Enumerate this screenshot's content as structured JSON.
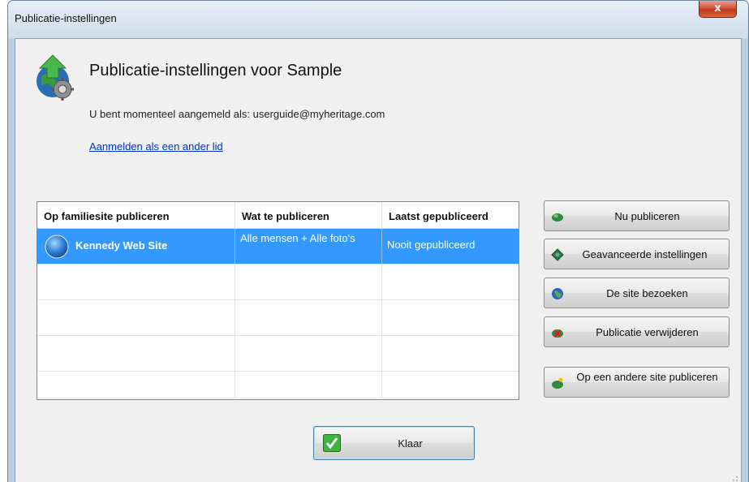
{
  "window": {
    "title": "Publicatie-instellingen",
    "close_glyph": "x"
  },
  "header": {
    "title": "Publicatie-instellingen voor Sample",
    "signed_in_text": "U bent momenteel aangemeld als: userguide@myheritage.com",
    "change_member_link": "Aanmelden als een ander lid",
    "icon": "publish-gear-globe-icon"
  },
  "table": {
    "columns": [
      "Op familiesite publiceren",
      "Wat te publiceren",
      "Laatst gepubliceerd"
    ],
    "rows": [
      {
        "site": "Kennedy Web Site",
        "what": "Alle mensen + Alle foto's",
        "when": "Nooit gepubliceerd",
        "selected": true,
        "icon": "globe-icon"
      }
    ],
    "empty_rows": 4,
    "selection_color": "#3399ff"
  },
  "actions": [
    {
      "label": "Nu publiceren",
      "icon": "publish-now-icon"
    },
    {
      "label": "Geavanceerde instellingen",
      "icon": "advanced-settings-icon"
    },
    {
      "label": "De site bezoeken",
      "icon": "visit-site-icon"
    },
    {
      "label": "Publicatie verwijderen",
      "icon": "remove-publication-icon"
    },
    {
      "label": "Op een andere site publiceren",
      "icon": "publish-other-site-icon"
    }
  ],
  "footer": {
    "done_label": "Klaar",
    "done_icon": "checkmark-icon"
  },
  "colors": {
    "link": "#0033cc",
    "close": "#c1381e",
    "check": "#2ea52e"
  }
}
